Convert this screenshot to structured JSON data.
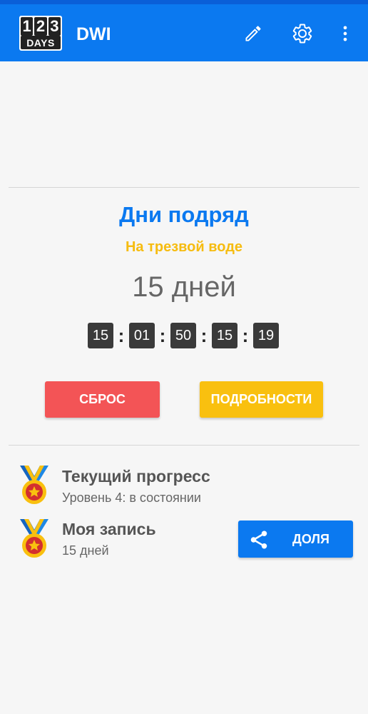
{
  "app": {
    "logo": {
      "digits": [
        "1",
        "2",
        "3"
      ],
      "label": "DAYS"
    },
    "title": "DWI",
    "icons": [
      "edit-icon",
      "settings-icon",
      "more-vert-icon"
    ]
  },
  "counter": {
    "title": "Дни подряд",
    "subtitle": "На трезвой воде",
    "days_text": "15 дней",
    "timer": [
      "15",
      "01",
      "50",
      "15",
      "19"
    ]
  },
  "buttons": {
    "reset": "СБРОС",
    "details": "ПОДРОБНОСТИ"
  },
  "progress": {
    "current_title": "Текущий прогресс",
    "current_level": "Уровень 4: в состоянии",
    "record_title": "Моя запись",
    "record_value": "15 дней",
    "share_label": "ДОЛЯ"
  },
  "colors": {
    "primary": "#0b79f0",
    "accent_yellow": "#f9c00f",
    "reset_red": "#f35456"
  }
}
